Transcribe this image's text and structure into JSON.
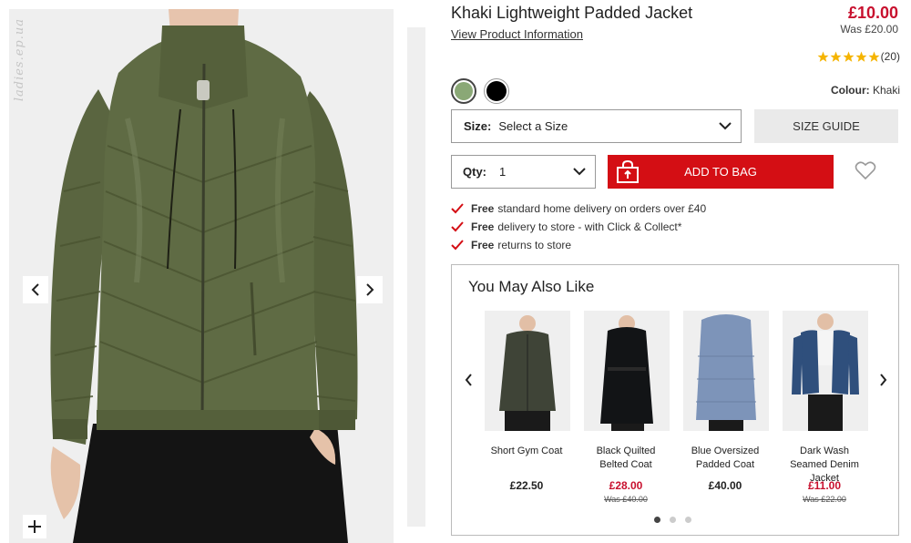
{
  "gallery": {
    "watermark": "ladies.ep.ua",
    "prev_icon": "chevron-left-icon",
    "next_icon": "chevron-right-icon",
    "zoom_icon": "plus-icon"
  },
  "product": {
    "title": "Khaki Lightweight Padded Jacket",
    "view_info": "View Product Information",
    "price": "£10.00",
    "was_price": "Was £20.00",
    "rating_stars": 5,
    "review_count": "(20)",
    "swatch_colors": [
      "#8aa876",
      "#000000"
    ],
    "colour_label": "Colour:",
    "colour_value": "Khaki"
  },
  "size": {
    "label": "Size:",
    "value": "Select a Size",
    "guide_button": "SIZE GUIDE"
  },
  "qty": {
    "label": "Qty:",
    "value": "1"
  },
  "cart": {
    "add_label": "ADD TO BAG",
    "accent_color": "#d40e14"
  },
  "benefits": [
    {
      "bold": "Free",
      "text": "standard home delivery on orders over £40"
    },
    {
      "bold": "Free",
      "text": "delivery to store - with Click & Collect*"
    },
    {
      "bold": "Free",
      "text": "returns to store"
    }
  ],
  "recommendations": {
    "title": "You May Also Like",
    "items": [
      {
        "name": "Short Gym Coat",
        "price": "£22.50",
        "was": "",
        "color": "#3f4437"
      },
      {
        "name": "Black Quilted Belted Coat",
        "price": "£28.00",
        "was": "Was £40.00",
        "color": "#121416"
      },
      {
        "name": "Blue Oversized Padded Coat",
        "price": "£40.00",
        "was": "",
        "color": "#7d94b9"
      },
      {
        "name": "Dark Wash Seamed Denim Jacket",
        "price": "£11.00",
        "was": "Was £22.00",
        "color": "#2f4f7c"
      }
    ],
    "page_count": 3,
    "active_page": 1
  }
}
